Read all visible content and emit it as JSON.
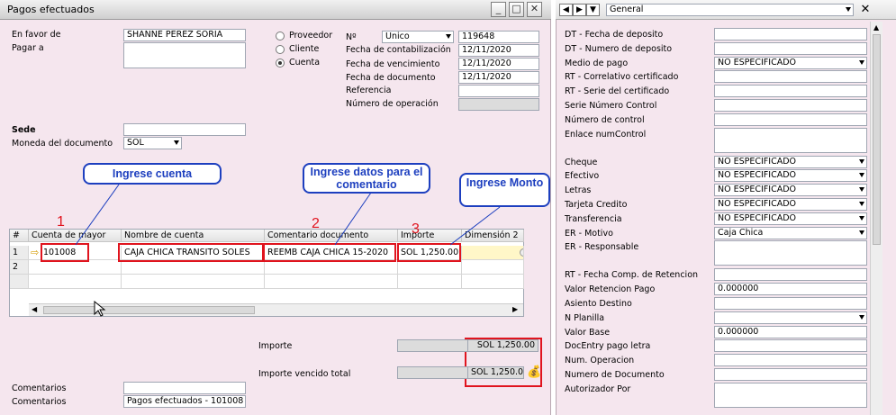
{
  "window": {
    "title": "Pagos efectuados"
  },
  "header_left": {
    "en_favor_label": "En favor de",
    "en_favor_value": "SHANNE PEREZ SORIA",
    "pagar_a_label": "Pagar a",
    "sede_label": "Sede",
    "moneda_label": "Moneda del documento",
    "moneda_value": "SOL"
  },
  "radios": [
    {
      "label": "Proveedor",
      "selected": false
    },
    {
      "label": "Cliente",
      "selected": false
    },
    {
      "label": "Cuenta",
      "selected": true
    }
  ],
  "header_right": {
    "no_label": "Nº",
    "series": "Unico",
    "doc_number": "119648",
    "fecha_contab_label": "Fecha de contabilización",
    "fecha_contab": "12/11/2020",
    "fecha_venc_label": "Fecha de vencimiento",
    "fecha_venc": "12/11/2020",
    "fecha_doc_label": "Fecha de documento",
    "fecha_doc": "12/11/2020",
    "referencia_label": "Referencia",
    "num_operacion_label": "Número de operación"
  },
  "grid": {
    "columns": [
      "#",
      "Cuenta de mayor",
      "Nombre de cuenta",
      "Comentario documento",
      "Importe",
      "Dimensión 2"
    ],
    "rows": [
      {
        "n": "1",
        "cuenta": "101008",
        "nombre": "CAJA CHICA TRANSITO SOLES",
        "comentario": "REEMB CAJA CHICA 15-2020",
        "importe": "SOL 1,250.00"
      },
      {
        "n": "2",
        "cuenta": "",
        "nombre": "",
        "comentario": "",
        "importe": ""
      }
    ]
  },
  "callouts": {
    "cuenta": "Ingrese cuenta",
    "comentario": "Ingrese datos para el comentario",
    "monto": "Ingrese Monto",
    "n1": "1",
    "n2": "2",
    "n3": "3"
  },
  "totals": {
    "importe_label": "Importe",
    "importe_value": "SOL 1,250.00",
    "vencido_label": "Importe vencido total",
    "vencido_value": "SOL 1,250.00"
  },
  "footer": {
    "comentarios_label": "Comentarios",
    "comentarios_label2": "Comentarios",
    "comentarios_value": "Pagos efectuados - 101008"
  },
  "panel": {
    "category": "General",
    "fields": [
      {
        "label": "DT - Fecha de deposito",
        "value": ""
      },
      {
        "label": "DT - Numero de deposito",
        "value": ""
      },
      {
        "label": "Medio de pago",
        "value": "NO ESPECIFICADO",
        "dropdown": true
      },
      {
        "label": "RT - Correlativo certificado",
        "value": ""
      },
      {
        "label": "RT - Serie del certificado",
        "value": ""
      },
      {
        "label": "Serie Número Control",
        "value": ""
      },
      {
        "label": "Número de control",
        "value": ""
      },
      {
        "label": "Enlace numControl",
        "value": "",
        "tall": true
      },
      {
        "label": "Cheque",
        "value": "NO ESPECIFICADO",
        "dropdown": true
      },
      {
        "label": "Efectivo",
        "value": "NO ESPECIFICADO",
        "dropdown": true
      },
      {
        "label": "Letras",
        "value": "NO ESPECIFICADO",
        "dropdown": true
      },
      {
        "label": "Tarjeta Credito",
        "value": "NO ESPECIFICADO",
        "dropdown": true
      },
      {
        "label": "Transferencia",
        "value": "NO ESPECIFICADO",
        "dropdown": true
      },
      {
        "label": "ER - Motivo",
        "value": "Caja Chica",
        "dropdown": true
      },
      {
        "label": "ER - Responsable",
        "value": "",
        "tall": true
      },
      {
        "label": "RT - Fecha Comp. de Retencion",
        "value": ""
      },
      {
        "label": "Valor Retencion Pago",
        "value": "0.000000"
      },
      {
        "label": "Asiento Destino",
        "value": ""
      },
      {
        "label": "N Planilla",
        "value": "",
        "dropdown": true
      },
      {
        "label": "Valor Base",
        "value": "0.000000"
      },
      {
        "label": "DocEntry pago letra",
        "value": ""
      },
      {
        "label": "Num. Operacion",
        "value": ""
      },
      {
        "label": "Numero de Documento",
        "value": ""
      },
      {
        "label": "Autorizador Por",
        "value": "",
        "tall": true
      }
    ]
  }
}
